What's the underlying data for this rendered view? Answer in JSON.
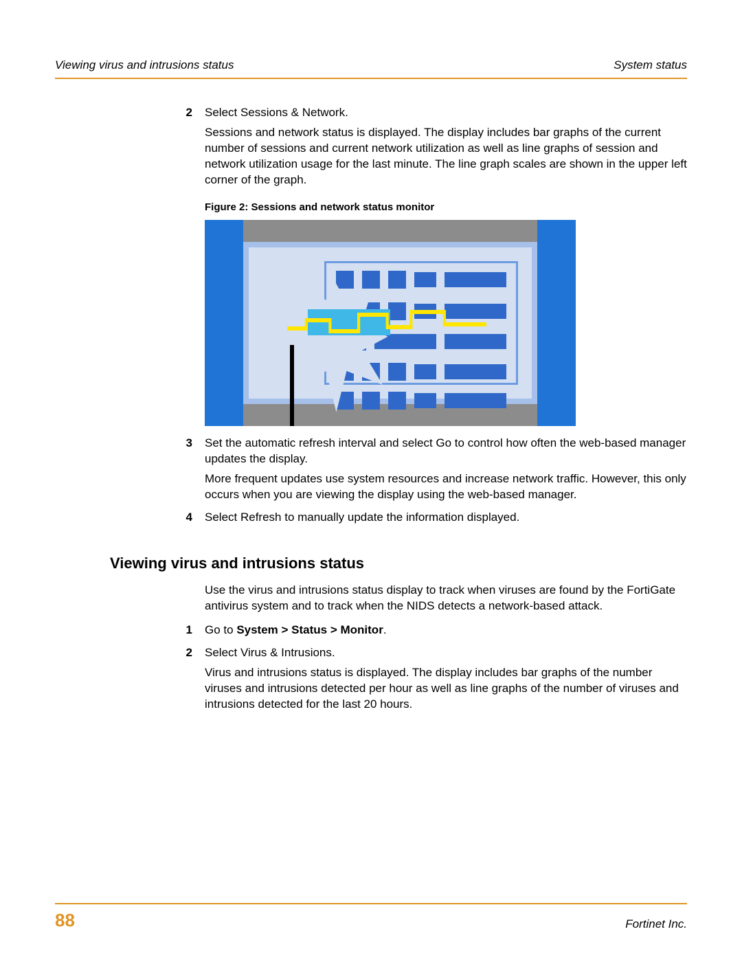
{
  "header": {
    "left": "Viewing virus and intrusions status",
    "right": "System status"
  },
  "steps_top": [
    {
      "num": "2",
      "lead": "Select Sessions & Network.",
      "detail": "Sessions and network status is displayed. The display includes bar graphs of the current number of sessions and current network utilization as well as line graphs of session and network utilization usage for the last minute. The line graph scales are shown in the upper left corner of the graph."
    },
    {
      "num": "3",
      "lead": "Set the automatic refresh interval and select Go to control how often the web-based manager updates the display.",
      "detail": "More frequent updates use system resources and increase network traffic. However, this only occurs when you are viewing the display using the web-based manager."
    },
    {
      "num": "4",
      "lead": "Select Refresh to manually update the information displayed.",
      "detail": ""
    }
  ],
  "figure": {
    "caption": "Figure 2:  Sessions and network status monitor"
  },
  "section": {
    "heading": "Viewing virus and intrusions status",
    "intro": "Use the virus and intrusions status display to track when viruses are found by the FortiGate antivirus system and to track when the NIDS detects a network-based attack."
  },
  "steps_bottom": [
    {
      "num": "1",
      "lead_prefix": "Go to ",
      "lead_bold": "System > Status > Monitor",
      "lead_suffix": "."
    },
    {
      "num": "2",
      "lead": "Select Virus & Intrusions.",
      "detail": "Virus and intrusions status is displayed. The display includes bar graphs of the number viruses and intrusions detected per hour as well as line graphs of the number of viruses and intrusions detected for the last 20 hours."
    }
  ],
  "footer": {
    "page": "88",
    "brand": "Fortinet Inc."
  }
}
